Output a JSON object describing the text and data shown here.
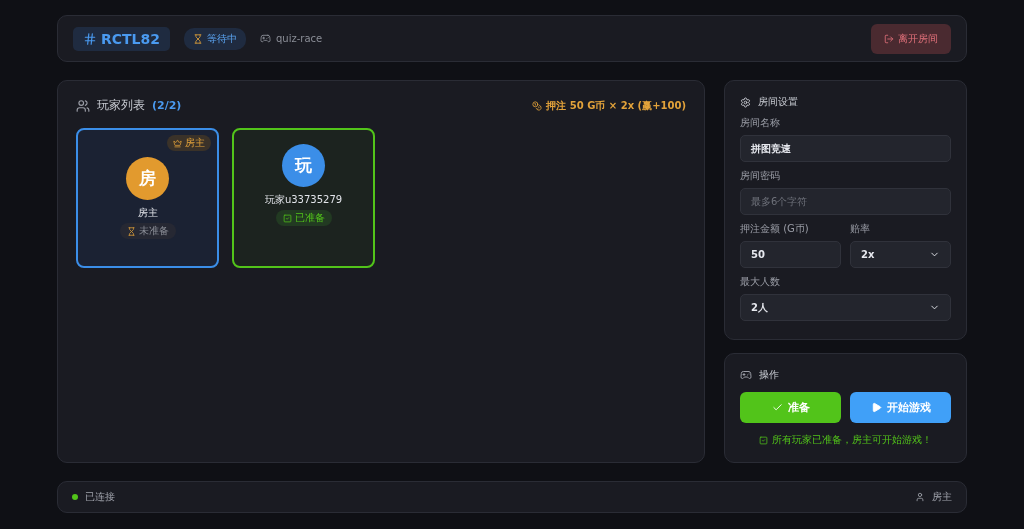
{
  "header": {
    "room_code": "RCTL82",
    "status": "等待中",
    "game": "quiz-race",
    "leave_button": "离开房间"
  },
  "players": {
    "title": "玩家列表",
    "count": "(2/2)",
    "bet_summary": "押注 50 G币 × 2x (赢+100)",
    "items": [
      {
        "avatar": "房",
        "color": "#e29a2e",
        "name": "房主",
        "host": true,
        "host_badge": "房主",
        "ready": false,
        "status": "未准备"
      },
      {
        "avatar": "玩",
        "color": "#3b8ee8",
        "name": "玩家u33735279",
        "host": false,
        "ready": true,
        "status": "已准备"
      }
    ]
  },
  "settings": {
    "title": "房间设置",
    "rows": [
      [
        {
          "kind": "text",
          "label": "房间名称",
          "value": "拼图竞速"
        }
      ],
      [
        {
          "kind": "text",
          "label": "房间密码",
          "placeholder": "最多6个字符"
        }
      ],
      [
        {
          "kind": "text",
          "label": "押注金额 (G币)",
          "value": "50"
        },
        {
          "kind": "select",
          "label": "赔率",
          "value": "2x"
        }
      ],
      [
        {
          "kind": "select",
          "label": "最大人数",
          "value": "2人"
        }
      ]
    ]
  },
  "actions": {
    "title": "操作",
    "buttons": [
      {
        "kind": "ready",
        "label": "准备"
      },
      {
        "kind": "start",
        "label": "开始游戏"
      }
    ],
    "note": "所有玩家已准备，房主可开始游戏！"
  },
  "status_bar": {
    "connected": true,
    "connection": "已连接",
    "user": "房主"
  }
}
